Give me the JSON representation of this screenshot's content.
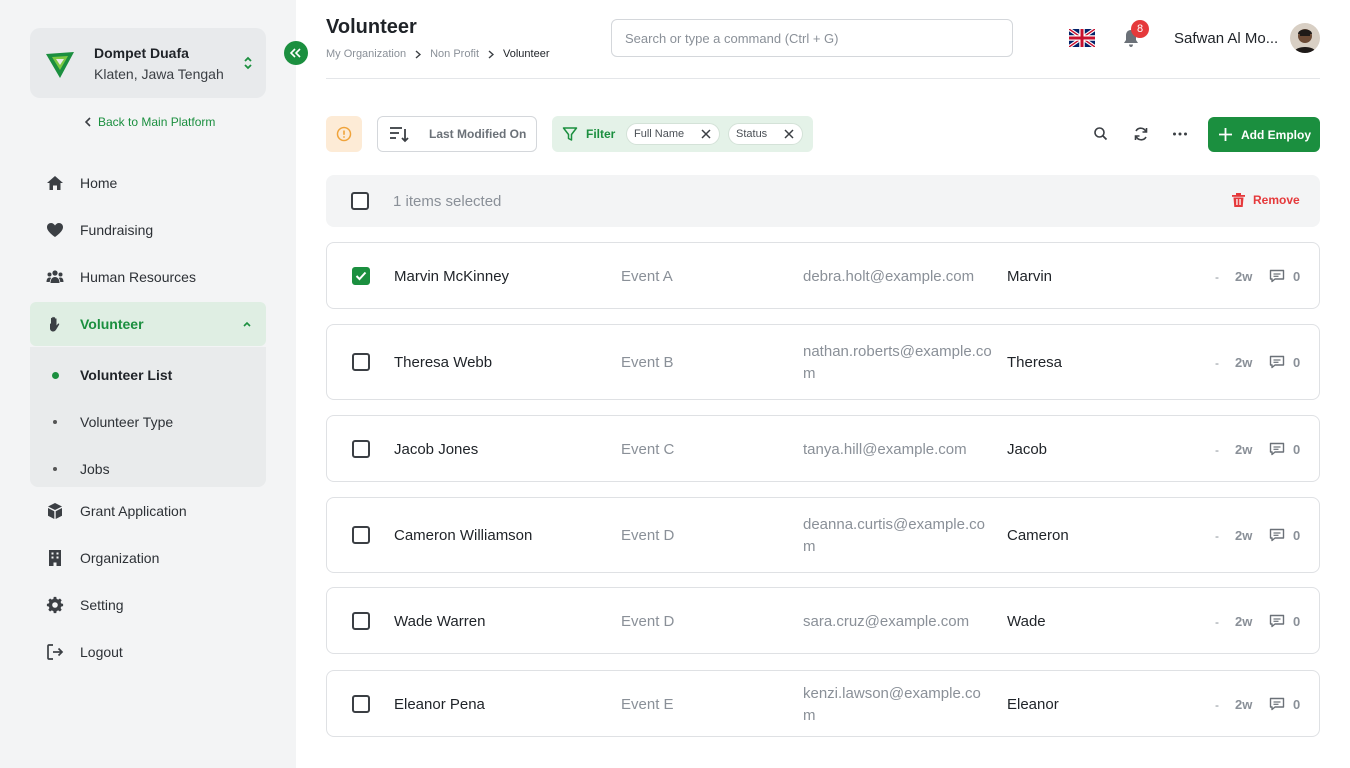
{
  "sidebar": {
    "org": {
      "name": "Dompet Duafa",
      "location": "Klaten, Jawa Tengah"
    },
    "back_label": "Back to Main Platform",
    "items": [
      {
        "label": "Home",
        "icon": "home-icon"
      },
      {
        "label": "Fundraising",
        "icon": "heart-icon"
      },
      {
        "label": "Human Resources",
        "icon": "users-icon"
      },
      {
        "label": "Volunteer",
        "icon": "hand-icon",
        "active": true
      },
      {
        "label": "Grant Application",
        "icon": "box-icon"
      },
      {
        "label": "Organization",
        "icon": "building-icon"
      },
      {
        "label": "Setting",
        "icon": "gear-icon"
      },
      {
        "label": "Logout",
        "icon": "logout-icon"
      }
    ],
    "sub_items": [
      {
        "label": "Volunteer List",
        "active": true
      },
      {
        "label": "Volunteer Type"
      },
      {
        "label": "Jobs"
      }
    ]
  },
  "header": {
    "title": "Volunteer",
    "breadcrumb": [
      "My Organization",
      "Non Profit",
      "Volunteer"
    ],
    "search_placeholder": "Search or type a command (Ctrl + G)",
    "notification_count": "8",
    "user_name": "Safwan Al Mo..."
  },
  "toolbar": {
    "sort_label": "Last Modified On",
    "filter_label": "Filter",
    "chips": [
      "Full Name",
      "Status"
    ],
    "add_label": "Add Employ"
  },
  "selection": {
    "count_text": "1 items selected",
    "remove_label": "Remove"
  },
  "rows": [
    {
      "name": "Marvin McKinney",
      "event": "Event A",
      "email": "debra.holt@example.com",
      "first": "Marvin",
      "dash": "-",
      "age": "2w",
      "comments": "0",
      "checked": true
    },
    {
      "name": "Theresa Webb",
      "event": "Event B",
      "email": "nathan.roberts@example.com",
      "first": "Theresa",
      "dash": "-",
      "age": "2w",
      "comments": "0",
      "checked": false
    },
    {
      "name": "Jacob Jones",
      "event": "Event C",
      "email": "tanya.hill@example.com",
      "first": "Jacob",
      "dash": "-",
      "age": "2w",
      "comments": "0",
      "checked": false
    },
    {
      "name": "Cameron Williamson",
      "event": "Event D",
      "email": "deanna.curtis@example.com",
      "first": "Cameron",
      "dash": "-",
      "age": "2w",
      "comments": "0",
      "checked": false
    },
    {
      "name": "Wade Warren",
      "event": "Event D",
      "email": "sara.cruz@example.com",
      "first": "Wade",
      "dash": "-",
      "age": "2w",
      "comments": "0",
      "checked": false
    },
    {
      "name": "Eleanor Pena",
      "event": "Event E",
      "email": "kenzi.lawson@example.com",
      "first": "Eleanor",
      "dash": "-",
      "age": "2w",
      "comments": "0",
      "checked": false
    }
  ],
  "colors": {
    "brand": "#1b8f3f",
    "danger": "#e5393b",
    "warning_bg": "#fdebd6"
  }
}
